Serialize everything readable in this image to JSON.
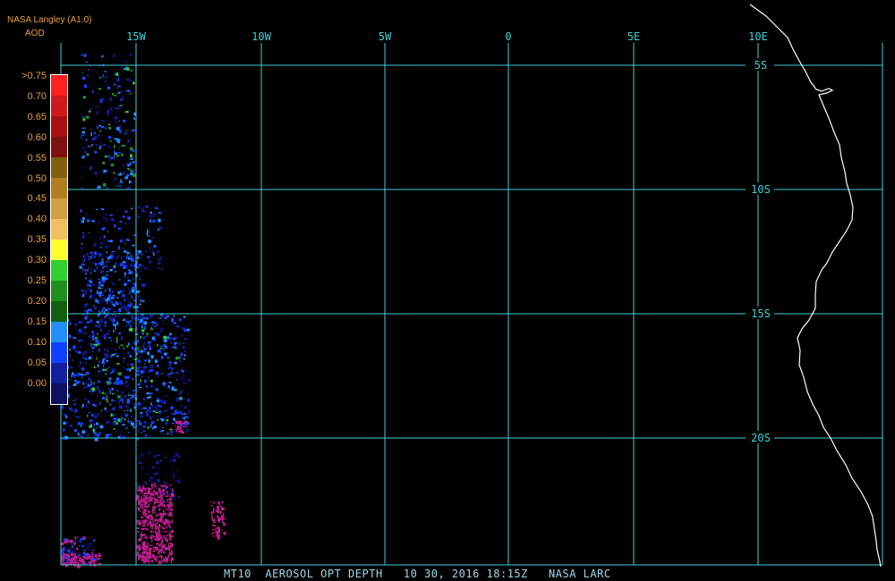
{
  "header": {
    "product": "NASA Langley (A1.0)",
    "variable": "AOD"
  },
  "colors": {
    "grid": "#40d0d8",
    "coast": "#ffffff",
    "text": "#e8a040",
    "background": "#000000"
  },
  "longitude_labels": [
    "15W",
    "10W",
    "5W",
    "0",
    "5E",
    "10E"
  ],
  "latitude_labels": [
    "5S",
    "10S",
    "15S",
    "20S"
  ],
  "legend": {
    "labels": [
      ">0.75",
      "0.70",
      "0.65",
      "0.60",
      "0.55",
      "0.50",
      "0.45",
      "0.40",
      "0.35",
      "0.30",
      "0.25",
      "0.20",
      "0.15",
      "0.10",
      "0.05",
      "0.00"
    ],
    "colors": [
      "#ff2020",
      "#d01818",
      "#a81010",
      "#801010",
      "#806010",
      "#b08020",
      "#d0a040",
      "#f0c060",
      "#ffff30",
      "#30d030",
      "#209020",
      "#106010",
      "#2090ff",
      "#1040ff",
      "#1020a0",
      "#101060",
      "#c02090"
    ]
  },
  "caption": "MT10  AEROSOL OPT DEPTH   10 30, 2016 18:15Z   NASA LARC"
}
